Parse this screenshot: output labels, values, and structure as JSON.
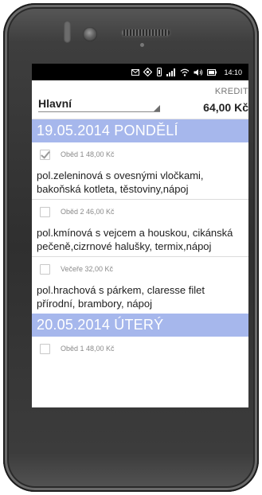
{
  "status_bar": {
    "time": "14:10",
    "icons": [
      "mail-icon",
      "gps-icon",
      "vibrate-icon",
      "signal-icon",
      "wifi-icon",
      "volume-icon",
      "battery-icon"
    ]
  },
  "header": {
    "selector_value": "Hlavní",
    "credit_label": "KREDIT",
    "credit_value": "64,00 Kč"
  },
  "days": [
    {
      "title": "19.05.2014  PONDĚLÍ",
      "items": [
        {
          "checked": true,
          "title": "Oběd 1  48,00 Kč",
          "description": "pol.zeleninová s ovesnými vločkami, bakoňská kotleta, těstoviny,nápoj"
        },
        {
          "checked": false,
          "title": "Oběd 2  46,00 Kč",
          "description": "pol.kmínová s vejcem a houskou, cikánská pečeně,cizrnové halušky, termix,nápoj"
        },
        {
          "checked": false,
          "title": "Večeře  32,00 Kč",
          "description": "pol.hrachová s párkem, claresse filet přírodní, brambory, nápoj"
        }
      ]
    },
    {
      "title": "20.05.2014  ÚTERÝ",
      "items": [
        {
          "checked": false,
          "title": "Oběd 1  48,00 Kč"
        }
      ]
    }
  ],
  "colors": {
    "day_header_bg": "#a6b7ec",
    "status_bar_bg": "#000000",
    "phone_body": "#3a3a3a"
  }
}
